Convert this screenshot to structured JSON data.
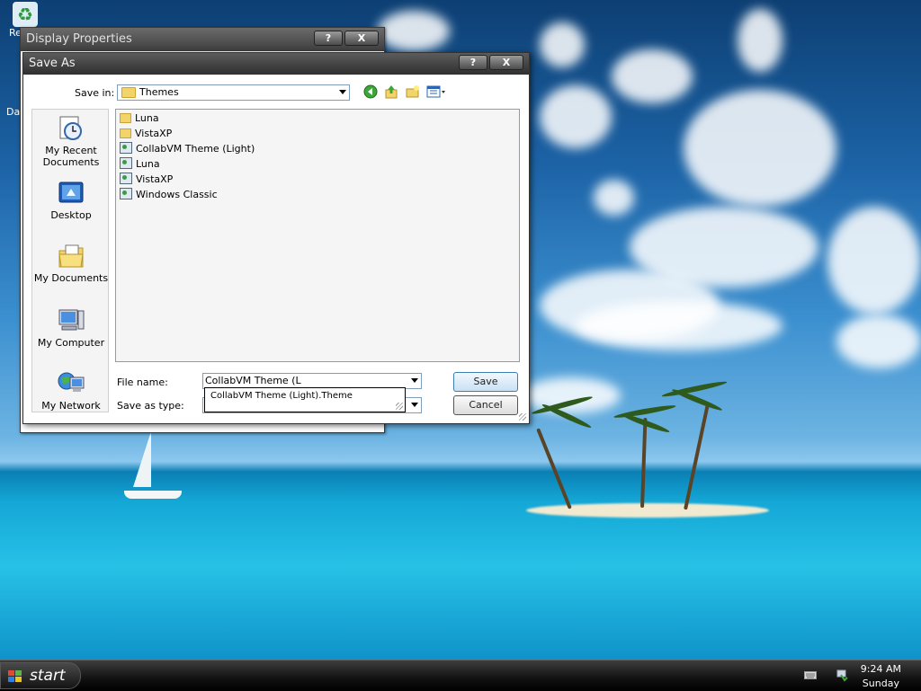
{
  "desktop": {
    "icons": [
      {
        "label": "Re"
      },
      {
        "label": "Da"
      }
    ]
  },
  "back_window": {
    "title": "Display Properties",
    "help_glyph": "?",
    "close_glyph": "X"
  },
  "dialog": {
    "title": "Save As",
    "help_glyph": "?",
    "close_glyph": "X",
    "save_in_label": "Save in:",
    "save_in_value": "Themes",
    "places": [
      {
        "label": "My Recent Documents",
        "icon": "recent-documents-icon"
      },
      {
        "label": "Desktop",
        "icon": "desktop-icon"
      },
      {
        "label": "My Documents",
        "icon": "my-documents-icon"
      },
      {
        "label": "My Computer",
        "icon": "my-computer-icon"
      },
      {
        "label": "My Network",
        "icon": "my-network-icon"
      }
    ],
    "files": [
      {
        "name": "Luna",
        "type": "folder"
      },
      {
        "name": "VistaXP",
        "type": "folder"
      },
      {
        "name": "CollabVM Theme (Light)",
        "type": "theme"
      },
      {
        "name": "Luna",
        "type": "theme"
      },
      {
        "name": "VistaXP",
        "type": "theme"
      },
      {
        "name": "Windows Classic",
        "type": "theme"
      }
    ],
    "file_name_label": "File name:",
    "file_name_value": "CollabVM Theme (L",
    "autocomplete_suggestion": "CollabVM Theme (Light).Theme",
    "save_as_type_label": "Save as type:",
    "save_label": "Save",
    "cancel_label": "Cancel"
  },
  "taskbar": {
    "start_label": "start",
    "clock_time": "9:24 AM",
    "clock_day": "Sunday"
  }
}
